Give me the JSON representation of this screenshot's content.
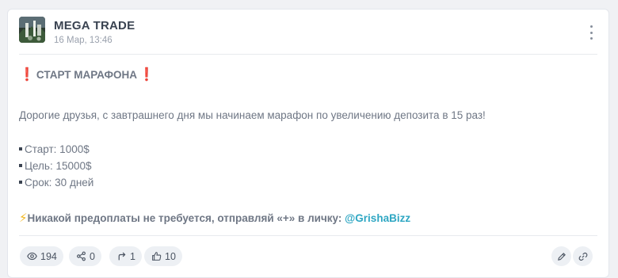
{
  "channel": {
    "name": "MEGA TRADE",
    "date": "16 Мар, 13:46",
    "avatar_icon": "channel-avatar"
  },
  "post": {
    "mark": "❗",
    "title": "СТАРТ МАРАФОНА",
    "intro": "Дорогие друзья, с завтрашнего дня мы начинаем марафон по увеличению депозита в 15 раз!",
    "items": [
      "Старт: 1000$",
      "Цель: 15000$",
      "Срок: 30 дней"
    ],
    "bolt": "⚡",
    "promo_text": "Никакой предоплаты не требуется, отправляй «+» в личку: ",
    "promo_link": "@GrishaBizz"
  },
  "stats": {
    "views": "194",
    "shares": "0",
    "forwards": "1",
    "reactions": "10"
  },
  "colors": {
    "accent_link": "#2fa7c3",
    "alert_red": "#d8242c",
    "bolt_yellow": "#f2b720"
  },
  "icons": [
    "more-vertical-icon",
    "eye-icon",
    "share-icon",
    "forward-icon",
    "thumbs-up-icon",
    "edit-pencil-icon",
    "link-icon"
  ]
}
